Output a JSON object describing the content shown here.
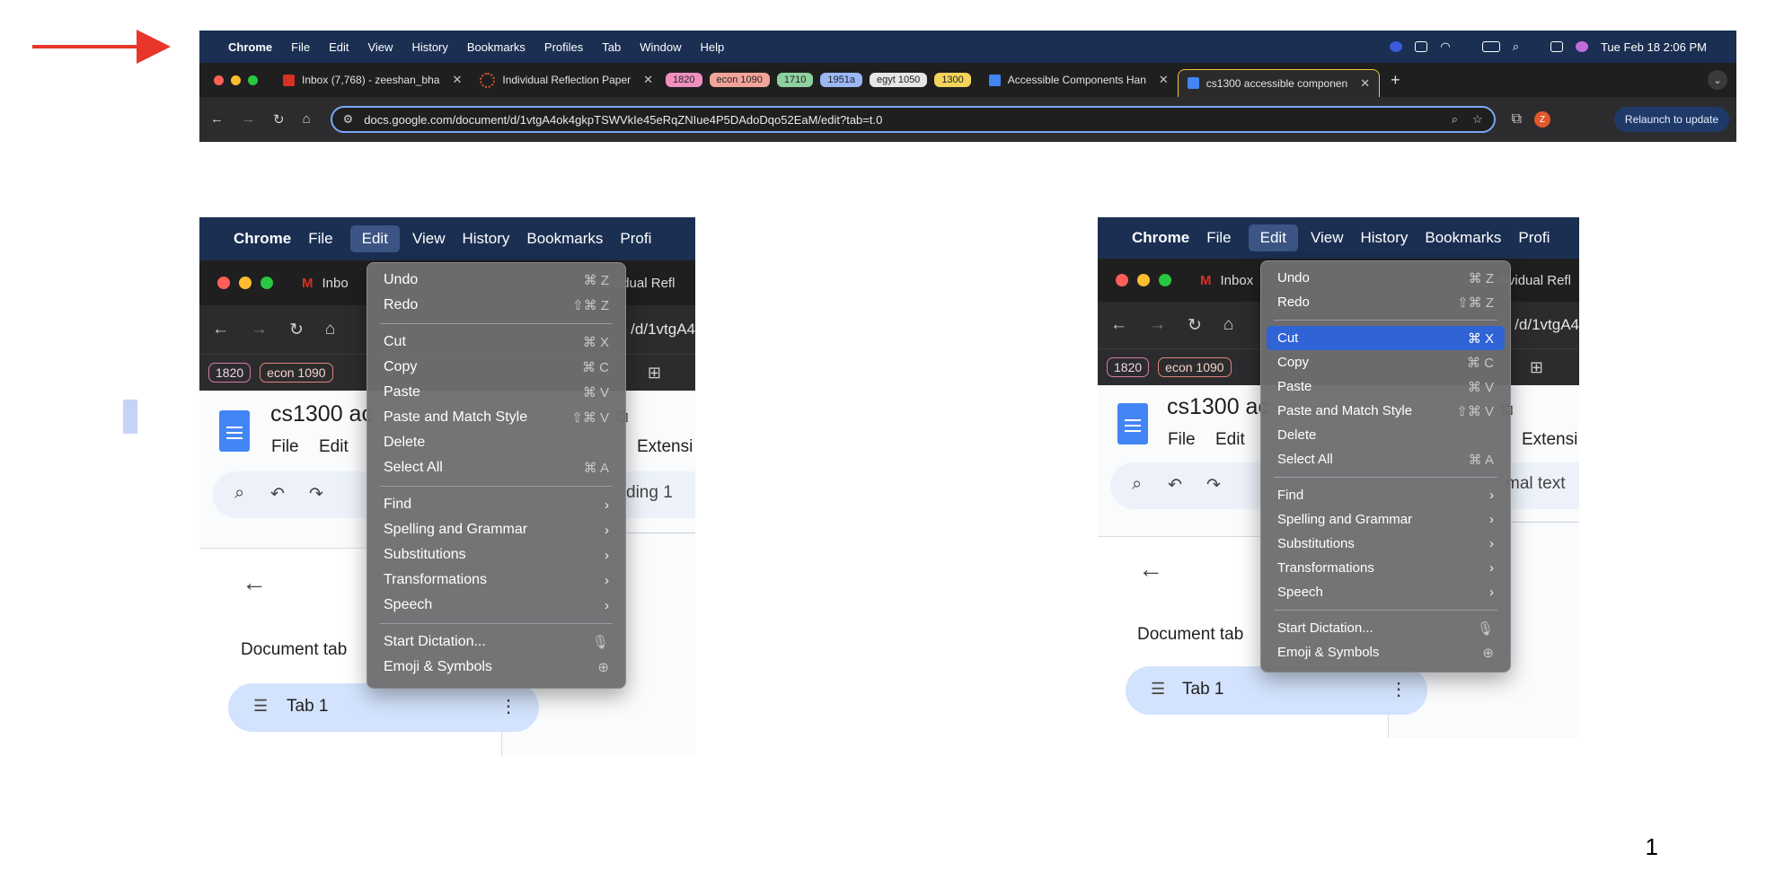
{
  "top": {
    "menubar": [
      "Chrome",
      "File",
      "Edit",
      "View",
      "History",
      "Bookmarks",
      "Profiles",
      "Tab",
      "Window",
      "Help"
    ],
    "datetime": "Tue Feb 18  2:06 PM",
    "tabs": {
      "inbox": "Inbox (7,768) - zeeshan_bha",
      "reflection": "Individual Reflection Paper",
      "chips": [
        {
          "label": "1820",
          "color": "#f08fc0"
        },
        {
          "label": "econ 1090",
          "color": "#f2a39a"
        },
        {
          "label": "1710",
          "color": "#8fd19e"
        },
        {
          "label": "1951a",
          "color": "#9bb8f5"
        },
        {
          "label": "egyt 1050",
          "color": "#e6e6e6"
        },
        {
          "label": "1300",
          "color": "#f3d35a"
        }
      ],
      "accessible": "Accessible Components Han",
      "active": "cs1300 accessible componen"
    },
    "url": "docs.google.com/document/d/1vtgA4ok4gkpTSWVkIe45eRqZNIue4P5DAdoDqo52EaM/edit?tab=t.0",
    "relaunch": "Relaunch to update",
    "avatar": "Z"
  },
  "left": {
    "menubar": [
      "Chrome",
      "File",
      "Edit",
      "View",
      "History",
      "Bookmarks",
      "Profi"
    ],
    "tab_inbox": "Inbo",
    "tab_reflection": "dividual Refl",
    "url_fragment": "/d/1vtgA4",
    "chips": [
      "1820",
      "econ 1090"
    ],
    "doc_title": "cs1300 ac",
    "doc_menu": [
      "File",
      "Edit"
    ],
    "doc_menu_right": "Extensi",
    "style_fragment": "ding 1",
    "tabs_heading": "Document tab",
    "tab1": "Tab 1",
    "menu": {
      "items": [
        {
          "label": "Undo",
          "shortcut": "⌘ Z"
        },
        {
          "label": "Redo",
          "shortcut": "⇧⌘ Z"
        },
        {
          "sep": true
        },
        {
          "label": "Cut",
          "shortcut": "⌘ X"
        },
        {
          "label": "Copy",
          "shortcut": "⌘ C"
        },
        {
          "label": "Paste",
          "shortcut": "⌘ V"
        },
        {
          "label": "Paste and Match Style",
          "shortcut": "⇧⌘ V"
        },
        {
          "label": "Delete",
          "shortcut": ""
        },
        {
          "label": "Select All",
          "shortcut": "⌘ A"
        },
        {
          "sep": true
        },
        {
          "label": "Find",
          "submenu": true
        },
        {
          "label": "Spelling and Grammar",
          "submenu": true
        },
        {
          "label": "Substitutions",
          "submenu": true
        },
        {
          "label": "Transformations",
          "submenu": true
        },
        {
          "label": "Speech",
          "submenu": true
        },
        {
          "sep": true
        },
        {
          "label": "Start Dictation...",
          "shortcut": "🎙"
        },
        {
          "label": "Emoji & Symbols",
          "shortcut": "⊕"
        }
      ]
    }
  },
  "right": {
    "menubar": [
      "Chrome",
      "File",
      "Edit",
      "View",
      "History",
      "Bookmarks",
      "Profi"
    ],
    "tab_inbox": "Inbox",
    "tab_reflection": "dividual Refl",
    "url_fragment": "/d/1vtgA4",
    "chips": [
      "1820",
      "econ 1090"
    ],
    "doc_title": "cs1300 ac",
    "doc_menu": [
      "File",
      "Edit"
    ],
    "doc_menu_right": "Extensi",
    "style_fragment": "mal text",
    "tabs_heading": "Document tab",
    "tab1": "Tab 1",
    "highlighted": "Cut"
  },
  "page_number": "1"
}
